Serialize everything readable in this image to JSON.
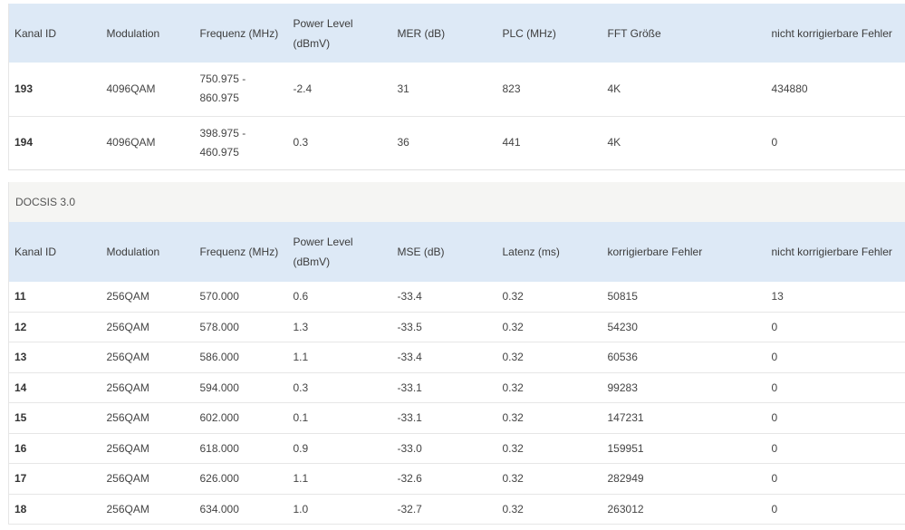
{
  "ofdm_table": {
    "headers": [
      "Kanal ID",
      "Modulation",
      "Frequenz (MHz)",
      "Power Level (dBmV)",
      "MER (dB)",
      "PLC (MHz)",
      "FFT Größe",
      "nicht korrigierbare Fehler"
    ],
    "rows": [
      {
        "id": "193",
        "modulation": "4096QAM",
        "freq_a": "750.975 -",
        "freq_b": "860.975",
        "power": "-2.4",
        "mer": "31",
        "plc": "823",
        "fft": "4K",
        "uncorr": "434880"
      },
      {
        "id": "194",
        "modulation": "4096QAM",
        "freq_a": "398.975 -",
        "freq_b": "460.975",
        "power": "0.3",
        "mer": "36",
        "plc": "441",
        "fft": "4K",
        "uncorr": "0"
      }
    ]
  },
  "docsis30": {
    "section_title": "DOCSIS 3.0",
    "headers": [
      "Kanal ID",
      "Modulation",
      "Frequenz (MHz)",
      "Power Level (dBmV)",
      "MSE (dB)",
      "Latenz (ms)",
      "korrigierbare Fehler",
      "nicht korrigierbare Fehler"
    ],
    "rows": [
      {
        "id": "11",
        "modulation": "256QAM",
        "freq": "570.000",
        "power": "0.6",
        "mse": "-33.4",
        "latency": "0.32",
        "corr": "50815",
        "uncorr": "13"
      },
      {
        "id": "12",
        "modulation": "256QAM",
        "freq": "578.000",
        "power": "1.3",
        "mse": "-33.5",
        "latency": "0.32",
        "corr": "54230",
        "uncorr": "0"
      },
      {
        "id": "13",
        "modulation": "256QAM",
        "freq": "586.000",
        "power": "1.1",
        "mse": "-33.4",
        "latency": "0.32",
        "corr": "60536",
        "uncorr": "0"
      },
      {
        "id": "14",
        "modulation": "256QAM",
        "freq": "594.000",
        "power": "0.3",
        "mse": "-33.1",
        "latency": "0.32",
        "corr": "99283",
        "uncorr": "0"
      },
      {
        "id": "15",
        "modulation": "256QAM",
        "freq": "602.000",
        "power": "0.1",
        "mse": "-33.1",
        "latency": "0.32",
        "corr": "147231",
        "uncorr": "0"
      },
      {
        "id": "16",
        "modulation": "256QAM",
        "freq": "618.000",
        "power": "0.9",
        "mse": "-33.0",
        "latency": "0.32",
        "corr": "159951",
        "uncorr": "0"
      },
      {
        "id": "17",
        "modulation": "256QAM",
        "freq": "626.000",
        "power": "1.1",
        "mse": "-32.6",
        "latency": "0.32",
        "corr": "282949",
        "uncorr": "0"
      },
      {
        "id": "18",
        "modulation": "256QAM",
        "freq": "634.000",
        "power": "1.0",
        "mse": "-32.7",
        "latency": "0.32",
        "corr": "263012",
        "uncorr": "0"
      }
    ]
  }
}
